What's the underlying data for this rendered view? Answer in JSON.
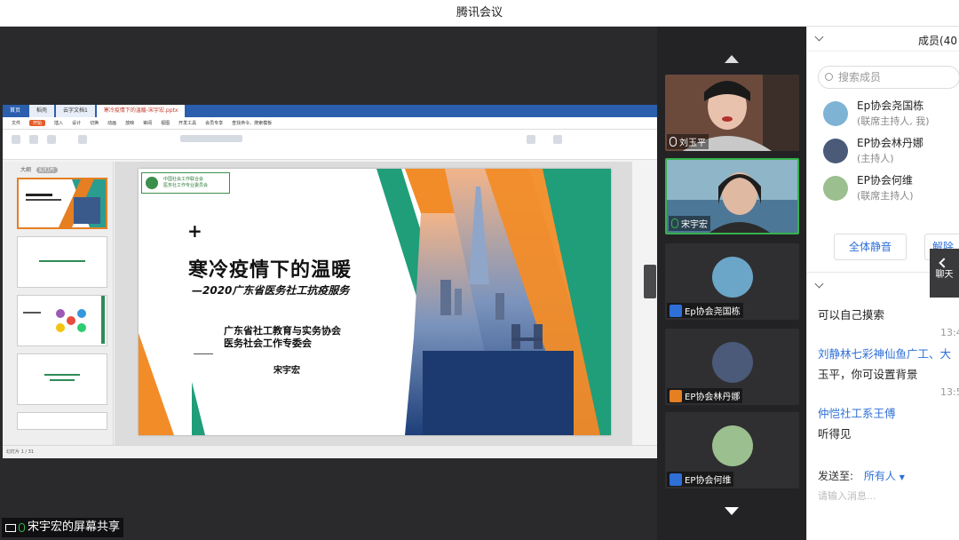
{
  "window": {
    "title": "腾讯会议"
  },
  "share": {
    "label": "宋宇宏的屏幕共享",
    "wps": {
      "tabs": [
        "首页",
        "稻壳",
        "云字文档1",
        "寒冷疫情下的温暖-宋宇宏.pptx"
      ],
      "menu": [
        "文件",
        "开始",
        "插入",
        "设计",
        "切换",
        "动画",
        "放映",
        "审阅",
        "视图",
        "开发工具",
        "会员专享",
        "查找命令、搜索模板"
      ],
      "menu_active": "开始",
      "thumb_header": "大纲",
      "thumb_tab": "幻灯片",
      "status": "幻灯片 1 / 31",
      "slide": {
        "logo_line1": "中国社会工作联合会",
        "logo_line2": "医务社工作专业委员会",
        "plus": "+",
        "title": "寒冷疫情下的温暖",
        "subtitle": "—2020广东省医务社工抗疫服务",
        "org_line1": "广东省社工教育与实务协会",
        "org_line2": "医务社会工作专委会",
        "author": "宋宇宏"
      }
    }
  },
  "video_tiles": [
    {
      "name": "刘玉平",
      "active": false
    },
    {
      "name": "宋宇宏",
      "active": true
    },
    {
      "name": "Ep协会尧国栋",
      "active": false
    },
    {
      "name": "EP协会林丹娜",
      "active": false
    },
    {
      "name": "EP协会何维",
      "active": false
    }
  ],
  "members": {
    "header": "成员(40",
    "search_placeholder": "搜索成员",
    "list": [
      {
        "name": "Ep协会尧国栋",
        "role": "(联席主持人, 我)"
      },
      {
        "name": "EP协会林丹娜",
        "role": "(主持人)"
      },
      {
        "name": "EP协会何维",
        "role": "(联席主持人)"
      }
    ],
    "mute_all": "全体静音",
    "unmute_all": "解除全"
  },
  "chat": {
    "messages": [
      {
        "text": "可以自己摸索",
        "kind": "dark"
      },
      {
        "text": "13:4",
        "kind": "gray"
      },
      {
        "text": "刘静林七彩神仙鱼广工、大",
        "kind": "blue"
      },
      {
        "text": "玉平，你可设置背景",
        "kind": "dark"
      },
      {
        "text": "13:5",
        "kind": "gray"
      },
      {
        "text": "仲恺社工系王傅",
        "kind": "blue"
      },
      {
        "text": "听得见",
        "kind": "dark"
      }
    ],
    "send_to_label": "发送至:",
    "send_to_value": "所有人",
    "input_placeholder": "请输入消息...",
    "collapse_label": "聊天"
  }
}
